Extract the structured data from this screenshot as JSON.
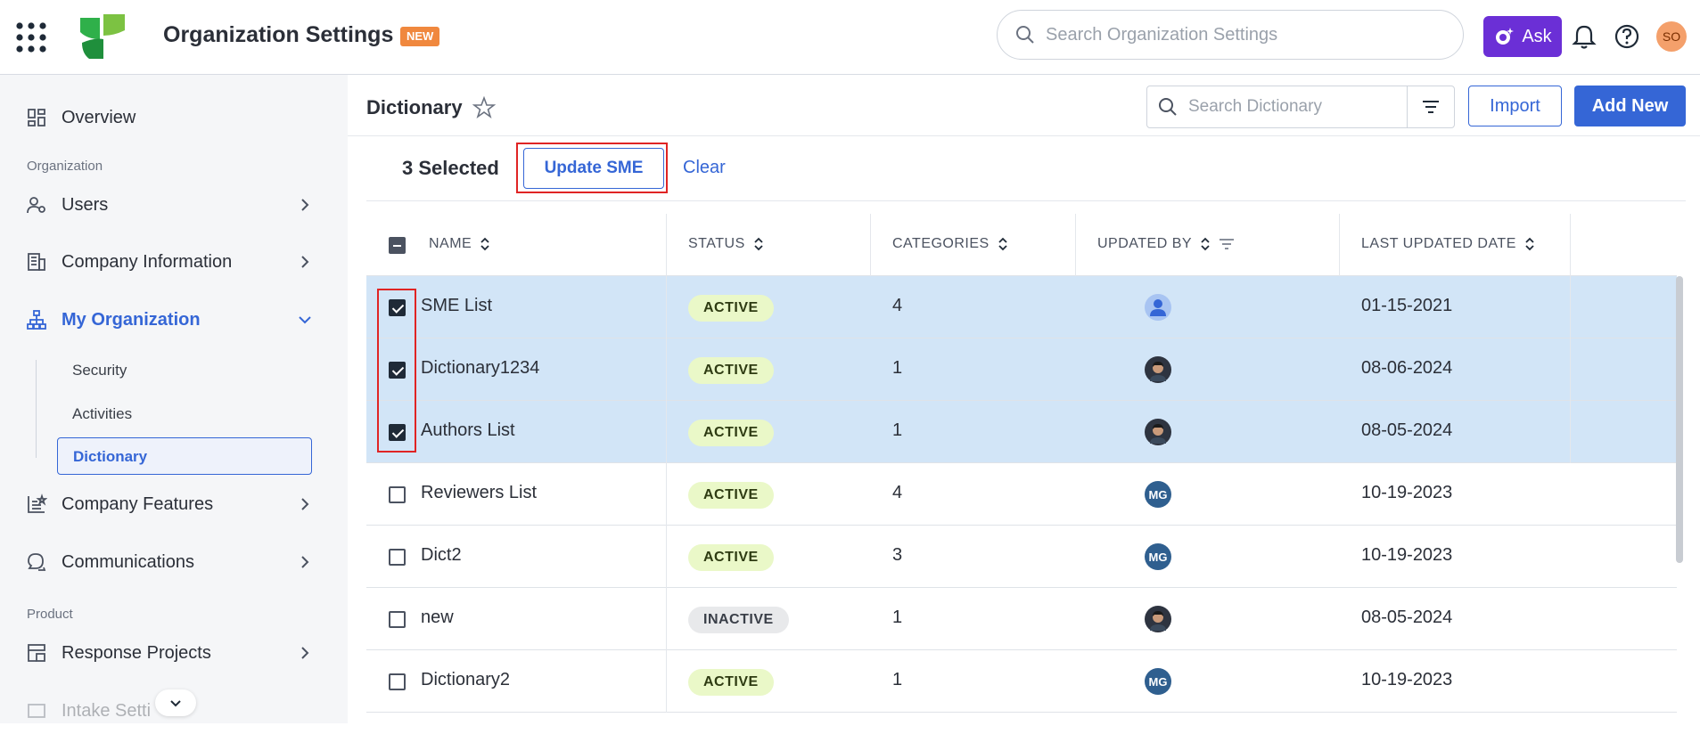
{
  "header": {
    "title": "Organization Settings",
    "badge": "NEW",
    "search_placeholder": "Search Organization Settings",
    "ask_label": "Ask",
    "user_initials": "SO"
  },
  "sidebar": {
    "overview": "Overview",
    "section_org": "Organization",
    "users": "Users",
    "company_info": "Company Information",
    "my_org": "My Organization",
    "sub": [
      "Security",
      "Activities",
      "Dictionary"
    ],
    "company_features": "Company Features",
    "communications": "Communications",
    "section_product": "Product",
    "response_projects": "Response Projects",
    "intake_settings": "Intake Setti"
  },
  "main": {
    "title": "Dictionary",
    "search_placeholder": "Search Dictionary",
    "import_label": "Import",
    "add_new_label": "Add New",
    "selected_text": "3 Selected",
    "update_sme_label": "Update SME",
    "clear_label": "Clear"
  },
  "table": {
    "columns": [
      "NAME",
      "STATUS",
      "CATEGORIES",
      "UPDATED BY",
      "LAST UPDATED DATE"
    ],
    "rows": [
      {
        "name": "SME List",
        "status": "ACTIVE",
        "categories": "4",
        "updated_by": "default",
        "date": "01-15-2021",
        "selected": true
      },
      {
        "name": "Dictionary1234",
        "status": "ACTIVE",
        "categories": "1",
        "updated_by": "photo",
        "date": "08-06-2024",
        "selected": true
      },
      {
        "name": "Authors List",
        "status": "ACTIVE",
        "categories": "1",
        "updated_by": "photo",
        "date": "08-05-2024",
        "selected": true
      },
      {
        "name": "Reviewers List",
        "status": "ACTIVE",
        "categories": "4",
        "updated_by": "MG",
        "date": "10-19-2023",
        "selected": false
      },
      {
        "name": "Dict2",
        "status": "ACTIVE",
        "categories": "3",
        "updated_by": "MG",
        "date": "10-19-2023",
        "selected": false
      },
      {
        "name": "new",
        "status": "INACTIVE",
        "categories": "1",
        "updated_by": "photo",
        "date": "08-05-2024",
        "selected": false
      },
      {
        "name": "Dictionary2",
        "status": "ACTIVE",
        "categories": "1",
        "updated_by": "MG",
        "date": "10-19-2023",
        "selected": false
      }
    ]
  },
  "colors": {
    "accent": "#3566d6",
    "ask_purple": "#6b2fd6",
    "selected_row": "#d2e5f7",
    "highlight_red": "#e02424"
  }
}
